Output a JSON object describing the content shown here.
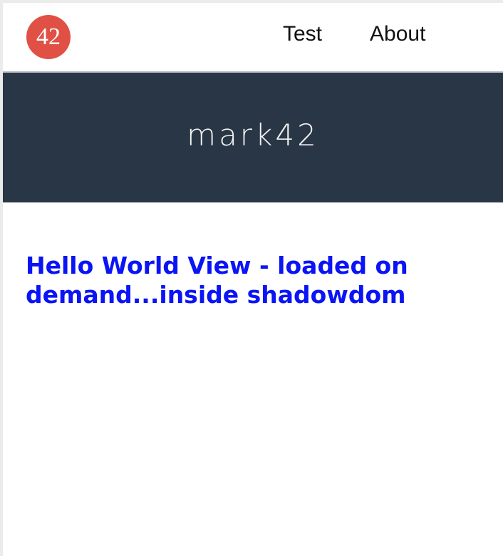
{
  "header": {
    "logo_text": "42",
    "nav": [
      {
        "label": "Test"
      },
      {
        "label": "About"
      }
    ]
  },
  "banner": {
    "title": "mark42"
  },
  "main": {
    "heading": "Hello World View - loaded on demand...inside shadowdom"
  },
  "colors": {
    "logo_bg": "#e05045",
    "banner_bg": "#293646",
    "heading": "#0a14f5"
  }
}
